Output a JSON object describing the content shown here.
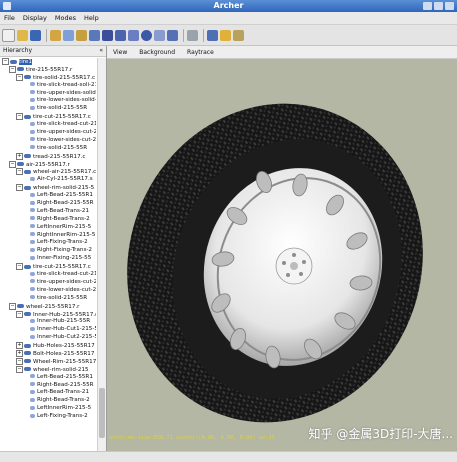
{
  "window": {
    "title": "Archer"
  },
  "menu": [
    "File",
    "Display",
    "Modes",
    "Help"
  ],
  "left_panel": {
    "title": "Hierarchy",
    "close_label": "«"
  },
  "tree": [
    {
      "label": "tire1",
      "depth": 0,
      "expander": "−",
      "selected": true
    },
    {
      "label": "tire-215-55R17.r",
      "depth": 1,
      "expander": "−"
    },
    {
      "label": "tire-solid-215-55R17.c",
      "depth": 2,
      "expander": "−"
    },
    {
      "label": "tire-slick-tread-soli-215",
      "depth": 3,
      "expander": ""
    },
    {
      "label": "tire-upper-sides-solid-2",
      "depth": 3,
      "expander": ""
    },
    {
      "label": "tire-lower-sides-solid-2",
      "depth": 3,
      "expander": ""
    },
    {
      "label": "tire-solid-215-55R",
      "depth": 3,
      "expander": ""
    },
    {
      "label": "tire-cut-215-55R17.c",
      "depth": 2,
      "expander": "−"
    },
    {
      "label": "tire-slick-tread-cut-215",
      "depth": 3,
      "expander": ""
    },
    {
      "label": "tire-upper-sides-cut-21",
      "depth": 3,
      "expander": ""
    },
    {
      "label": "tire-lower-sides-cut-21",
      "depth": 3,
      "expander": ""
    },
    {
      "label": "tire-solid-215-55R",
      "depth": 3,
      "expander": ""
    },
    {
      "label": "tread-215-55R17.c",
      "depth": 2,
      "expander": "+"
    },
    {
      "label": "air-215-55R17.r",
      "depth": 1,
      "expander": "−"
    },
    {
      "label": "wheel-air-215-55R17.c",
      "depth": 2,
      "expander": "−"
    },
    {
      "label": "Air-Cyl-215-55R17.s",
      "depth": 3,
      "expander": ""
    },
    {
      "label": "wheel-rim-solid-215-5",
      "depth": 2,
      "expander": "−"
    },
    {
      "label": "Left-Bead-215-55R1",
      "depth": 3,
      "expander": ""
    },
    {
      "label": "Right-Bead-215-55R",
      "depth": 3,
      "expander": ""
    },
    {
      "label": "Left-Bead-Trans-21",
      "depth": 3,
      "expander": ""
    },
    {
      "label": "Right-Bead-Trans-2",
      "depth": 3,
      "expander": ""
    },
    {
      "label": "LeftInnerRim-215-5",
      "depth": 3,
      "expander": ""
    },
    {
      "label": "RightInnerRim-215-5",
      "depth": 3,
      "expander": ""
    },
    {
      "label": "Left-Fixing-Trans-2",
      "depth": 3,
      "expander": ""
    },
    {
      "label": "Right-Fixing-Trans-2",
      "depth": 3,
      "expander": ""
    },
    {
      "label": "Inner-Fixing-215-55",
      "depth": 3,
      "expander": ""
    },
    {
      "label": "tire-cut-215-55R17.c",
      "depth": 2,
      "expander": "−"
    },
    {
      "label": "tire-slick-tread-cut-21",
      "depth": 3,
      "expander": ""
    },
    {
      "label": "tire-upper-sides-cut-21",
      "depth": 3,
      "expander": ""
    },
    {
      "label": "tire-lower-sides-cut-21",
      "depth": 3,
      "expander": ""
    },
    {
      "label": "tire-solid-215-55R",
      "depth": 3,
      "expander": ""
    },
    {
      "label": "wheel-215-55R17.r",
      "depth": 1,
      "expander": "−"
    },
    {
      "label": "Inner-Hub-215-55R17.c",
      "depth": 2,
      "expander": "−"
    },
    {
      "label": "Inner-Hub-215-55R",
      "depth": 3,
      "expander": ""
    },
    {
      "label": "Inner-Hub-Cut1-215-5",
      "depth": 3,
      "expander": ""
    },
    {
      "label": "Inner-Hub-Cut2-215-5",
      "depth": 3,
      "expander": ""
    },
    {
      "label": "Hub-Holes-215-55R17",
      "depth": 2,
      "expander": "+"
    },
    {
      "label": "Bolt-Holes-215-55R17",
      "depth": 2,
      "expander": "+"
    },
    {
      "label": "Wheel-Rim-215-55R17.c",
      "depth": 2,
      "expander": "−"
    },
    {
      "label": "wheel-rim-solid-215",
      "depth": 2,
      "expander": "−"
    },
    {
      "label": "Left-Bead-215-55R1",
      "depth": 3,
      "expander": ""
    },
    {
      "label": "Right-Bead-215-55R",
      "depth": 3,
      "expander": ""
    },
    {
      "label": "Left-Bead-Trans-21",
      "depth": 3,
      "expander": ""
    },
    {
      "label": "Right-Bead-Trans-2",
      "depth": 3,
      "expander": ""
    },
    {
      "label": "LeftInnerRim-215-5",
      "depth": 3,
      "expander": ""
    },
    {
      "label": "Left-Fixing-Trans-2",
      "depth": 3,
      "expander": ""
    }
  ],
  "tabs": [
    "View",
    "Background",
    "Raytrace"
  ],
  "viewport": {
    "status_text": "units:mm  size:850.71  center:(0.00, 0.00, 0.00)  az:35",
    "watermark": "知乎 @金属3D打印-大唐..."
  },
  "colors": {
    "titlebar": "#3f78c9",
    "viewport_bg": "#b4b7a3",
    "status_text": "#d9d24a",
    "selection": "#2f5fb3"
  }
}
